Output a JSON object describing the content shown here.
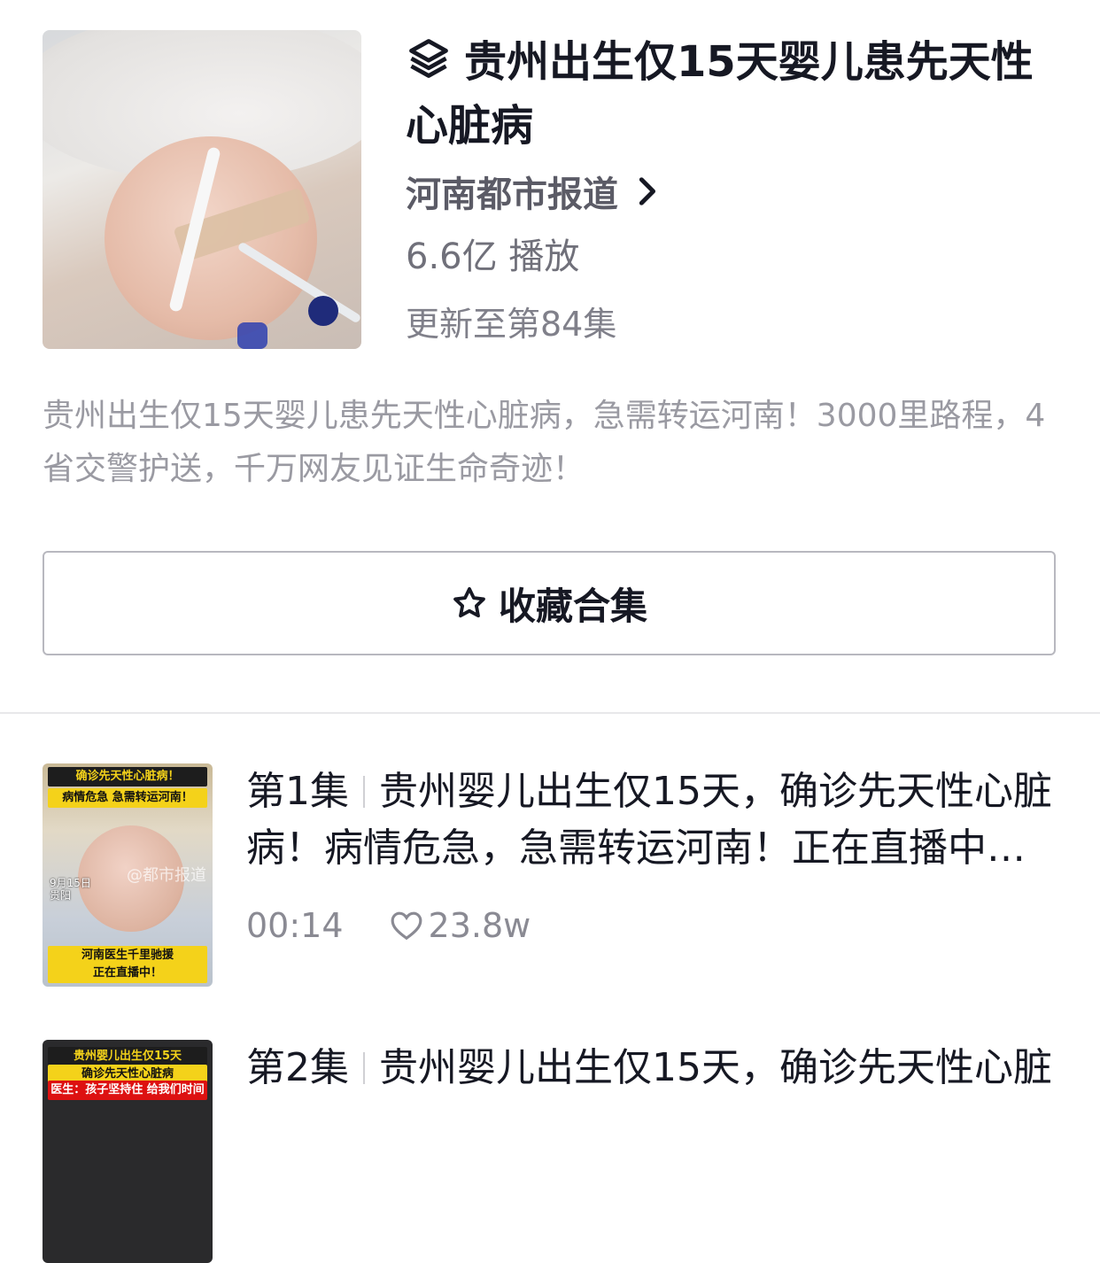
{
  "collection": {
    "title": "贵州出生仅15天婴儿患先天性心脏病",
    "author": "河南都市报道",
    "plays": "6.6亿 播放",
    "update_status": "更新至第84集",
    "description": "贵州出生仅15天婴儿患先天性心脏病，急需转运河南！3000里路程，4省交警护送，千万网友见证生命奇迹！",
    "collect_button": "收藏合集"
  },
  "episodes": [
    {
      "number": "第1集",
      "title": "贵州婴儿出生仅15天，确诊先天性心脏病！病情危急，急需转运河南！正在直播中…",
      "duration": "00:14",
      "likes": "23.8w",
      "thumb": {
        "line1": "确诊先天性心脏病！",
        "line2": "病情危急 急需转运河南！",
        "date": "9月15日",
        "place": "贵阳",
        "watermark": "@都市报道",
        "bottom1": "河南医生千里驰援",
        "bottom2": "正在直播中！"
      }
    },
    {
      "number": "第2集",
      "title": "贵州婴儿出生仅15天，确诊先天性心脏",
      "thumb": {
        "line1": "贵州婴儿出生仅15天",
        "line2": "确诊先天性心脏病",
        "line3": "医生：孩子坚持住 给我们时间"
      }
    }
  ],
  "icons": {
    "layers": "layers-icon",
    "chevron": "chevron-right-icon",
    "star": "star-outline-icon",
    "heart": "heart-outline-icon"
  }
}
